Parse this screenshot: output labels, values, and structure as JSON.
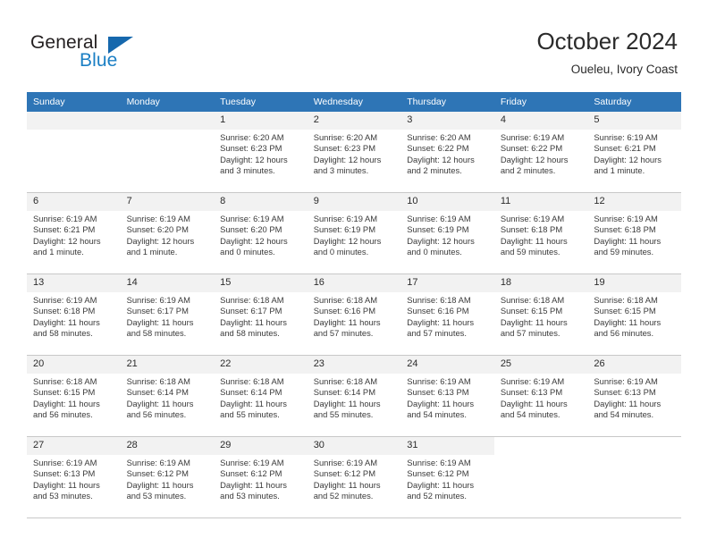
{
  "brand": {
    "name_part1": "General",
    "name_part2": "Blue",
    "triangle_color": "#1668ad",
    "blue_text_color": "#1b7fc4"
  },
  "header": {
    "title": "October 2024",
    "subtitle": "Oueleu, Ivory Coast",
    "accent_color": "#2e75b6"
  },
  "calendar": {
    "weekday_headers": [
      "Sunday",
      "Monday",
      "Tuesday",
      "Wednesday",
      "Thursday",
      "Friday",
      "Saturday"
    ],
    "weeks": [
      [
        {
          "day": "",
          "state": "empty",
          "sunrise": "",
          "sunset": "",
          "daylight1": "",
          "daylight2": ""
        },
        {
          "day": "",
          "state": "empty",
          "sunrise": "",
          "sunset": "",
          "daylight1": "",
          "daylight2": ""
        },
        {
          "day": "1",
          "state": "filled",
          "sunrise": "Sunrise: 6:20 AM",
          "sunset": "Sunset: 6:23 PM",
          "daylight1": "Daylight: 12 hours",
          "daylight2": "and 3 minutes."
        },
        {
          "day": "2",
          "state": "filled",
          "sunrise": "Sunrise: 6:20 AM",
          "sunset": "Sunset: 6:23 PM",
          "daylight1": "Daylight: 12 hours",
          "daylight2": "and 3 minutes."
        },
        {
          "day": "3",
          "state": "filled",
          "sunrise": "Sunrise: 6:20 AM",
          "sunset": "Sunset: 6:22 PM",
          "daylight1": "Daylight: 12 hours",
          "daylight2": "and 2 minutes."
        },
        {
          "day": "4",
          "state": "filled",
          "sunrise": "Sunrise: 6:19 AM",
          "sunset": "Sunset: 6:22 PM",
          "daylight1": "Daylight: 12 hours",
          "daylight2": "and 2 minutes."
        },
        {
          "day": "5",
          "state": "filled",
          "sunrise": "Sunrise: 6:19 AM",
          "sunset": "Sunset: 6:21 PM",
          "daylight1": "Daylight: 12 hours",
          "daylight2": "and 1 minute."
        }
      ],
      [
        {
          "day": "6",
          "state": "filled",
          "sunrise": "Sunrise: 6:19 AM",
          "sunset": "Sunset: 6:21 PM",
          "daylight1": "Daylight: 12 hours",
          "daylight2": "and 1 minute."
        },
        {
          "day": "7",
          "state": "filled",
          "sunrise": "Sunrise: 6:19 AM",
          "sunset": "Sunset: 6:20 PM",
          "daylight1": "Daylight: 12 hours",
          "daylight2": "and 1 minute."
        },
        {
          "day": "8",
          "state": "filled",
          "sunrise": "Sunrise: 6:19 AM",
          "sunset": "Sunset: 6:20 PM",
          "daylight1": "Daylight: 12 hours",
          "daylight2": "and 0 minutes."
        },
        {
          "day": "9",
          "state": "filled",
          "sunrise": "Sunrise: 6:19 AM",
          "sunset": "Sunset: 6:19 PM",
          "daylight1": "Daylight: 12 hours",
          "daylight2": "and 0 minutes."
        },
        {
          "day": "10",
          "state": "filled",
          "sunrise": "Sunrise: 6:19 AM",
          "sunset": "Sunset: 6:19 PM",
          "daylight1": "Daylight: 12 hours",
          "daylight2": "and 0 minutes."
        },
        {
          "day": "11",
          "state": "filled",
          "sunrise": "Sunrise: 6:19 AM",
          "sunset": "Sunset: 6:18 PM",
          "daylight1": "Daylight: 11 hours",
          "daylight2": "and 59 minutes."
        },
        {
          "day": "12",
          "state": "filled",
          "sunrise": "Sunrise: 6:19 AM",
          "sunset": "Sunset: 6:18 PM",
          "daylight1": "Daylight: 11 hours",
          "daylight2": "and 59 minutes."
        }
      ],
      [
        {
          "day": "13",
          "state": "filled",
          "sunrise": "Sunrise: 6:19 AM",
          "sunset": "Sunset: 6:18 PM",
          "daylight1": "Daylight: 11 hours",
          "daylight2": "and 58 minutes."
        },
        {
          "day": "14",
          "state": "filled",
          "sunrise": "Sunrise: 6:19 AM",
          "sunset": "Sunset: 6:17 PM",
          "daylight1": "Daylight: 11 hours",
          "daylight2": "and 58 minutes."
        },
        {
          "day": "15",
          "state": "filled",
          "sunrise": "Sunrise: 6:18 AM",
          "sunset": "Sunset: 6:17 PM",
          "daylight1": "Daylight: 11 hours",
          "daylight2": "and 58 minutes."
        },
        {
          "day": "16",
          "state": "filled",
          "sunrise": "Sunrise: 6:18 AM",
          "sunset": "Sunset: 6:16 PM",
          "daylight1": "Daylight: 11 hours",
          "daylight2": "and 57 minutes."
        },
        {
          "day": "17",
          "state": "filled",
          "sunrise": "Sunrise: 6:18 AM",
          "sunset": "Sunset: 6:16 PM",
          "daylight1": "Daylight: 11 hours",
          "daylight2": "and 57 minutes."
        },
        {
          "day": "18",
          "state": "filled",
          "sunrise": "Sunrise: 6:18 AM",
          "sunset": "Sunset: 6:15 PM",
          "daylight1": "Daylight: 11 hours",
          "daylight2": "and 57 minutes."
        },
        {
          "day": "19",
          "state": "filled",
          "sunrise": "Sunrise: 6:18 AM",
          "sunset": "Sunset: 6:15 PM",
          "daylight1": "Daylight: 11 hours",
          "daylight2": "and 56 minutes."
        }
      ],
      [
        {
          "day": "20",
          "state": "filled",
          "sunrise": "Sunrise: 6:18 AM",
          "sunset": "Sunset: 6:15 PM",
          "daylight1": "Daylight: 11 hours",
          "daylight2": "and 56 minutes."
        },
        {
          "day": "21",
          "state": "filled",
          "sunrise": "Sunrise: 6:18 AM",
          "sunset": "Sunset: 6:14 PM",
          "daylight1": "Daylight: 11 hours",
          "daylight2": "and 56 minutes."
        },
        {
          "day": "22",
          "state": "filled",
          "sunrise": "Sunrise: 6:18 AM",
          "sunset": "Sunset: 6:14 PM",
          "daylight1": "Daylight: 11 hours",
          "daylight2": "and 55 minutes."
        },
        {
          "day": "23",
          "state": "filled",
          "sunrise": "Sunrise: 6:18 AM",
          "sunset": "Sunset: 6:14 PM",
          "daylight1": "Daylight: 11 hours",
          "daylight2": "and 55 minutes."
        },
        {
          "day": "24",
          "state": "filled",
          "sunrise": "Sunrise: 6:19 AM",
          "sunset": "Sunset: 6:13 PM",
          "daylight1": "Daylight: 11 hours",
          "daylight2": "and 54 minutes."
        },
        {
          "day": "25",
          "state": "filled",
          "sunrise": "Sunrise: 6:19 AM",
          "sunset": "Sunset: 6:13 PM",
          "daylight1": "Daylight: 11 hours",
          "daylight2": "and 54 minutes."
        },
        {
          "day": "26",
          "state": "filled",
          "sunrise": "Sunrise: 6:19 AM",
          "sunset": "Sunset: 6:13 PM",
          "daylight1": "Daylight: 11 hours",
          "daylight2": "and 54 minutes."
        }
      ],
      [
        {
          "day": "27",
          "state": "filled",
          "sunrise": "Sunrise: 6:19 AM",
          "sunset": "Sunset: 6:13 PM",
          "daylight1": "Daylight: 11 hours",
          "daylight2": "and 53 minutes."
        },
        {
          "day": "28",
          "state": "filled",
          "sunrise": "Sunrise: 6:19 AM",
          "sunset": "Sunset: 6:12 PM",
          "daylight1": "Daylight: 11 hours",
          "daylight2": "and 53 minutes."
        },
        {
          "day": "29",
          "state": "filled",
          "sunrise": "Sunrise: 6:19 AM",
          "sunset": "Sunset: 6:12 PM",
          "daylight1": "Daylight: 11 hours",
          "daylight2": "and 53 minutes."
        },
        {
          "day": "30",
          "state": "filled",
          "sunrise": "Sunrise: 6:19 AM",
          "sunset": "Sunset: 6:12 PM",
          "daylight1": "Daylight: 11 hours",
          "daylight2": "and 52 minutes."
        },
        {
          "day": "31",
          "state": "filled",
          "sunrise": "Sunrise: 6:19 AM",
          "sunset": "Sunset: 6:12 PM",
          "daylight1": "Daylight: 11 hours",
          "daylight2": "and 52 minutes."
        },
        {
          "day": "",
          "state": "blank",
          "sunrise": "",
          "sunset": "",
          "daylight1": "",
          "daylight2": ""
        },
        {
          "day": "",
          "state": "blank",
          "sunrise": "",
          "sunset": "",
          "daylight1": "",
          "daylight2": ""
        }
      ]
    ]
  }
}
